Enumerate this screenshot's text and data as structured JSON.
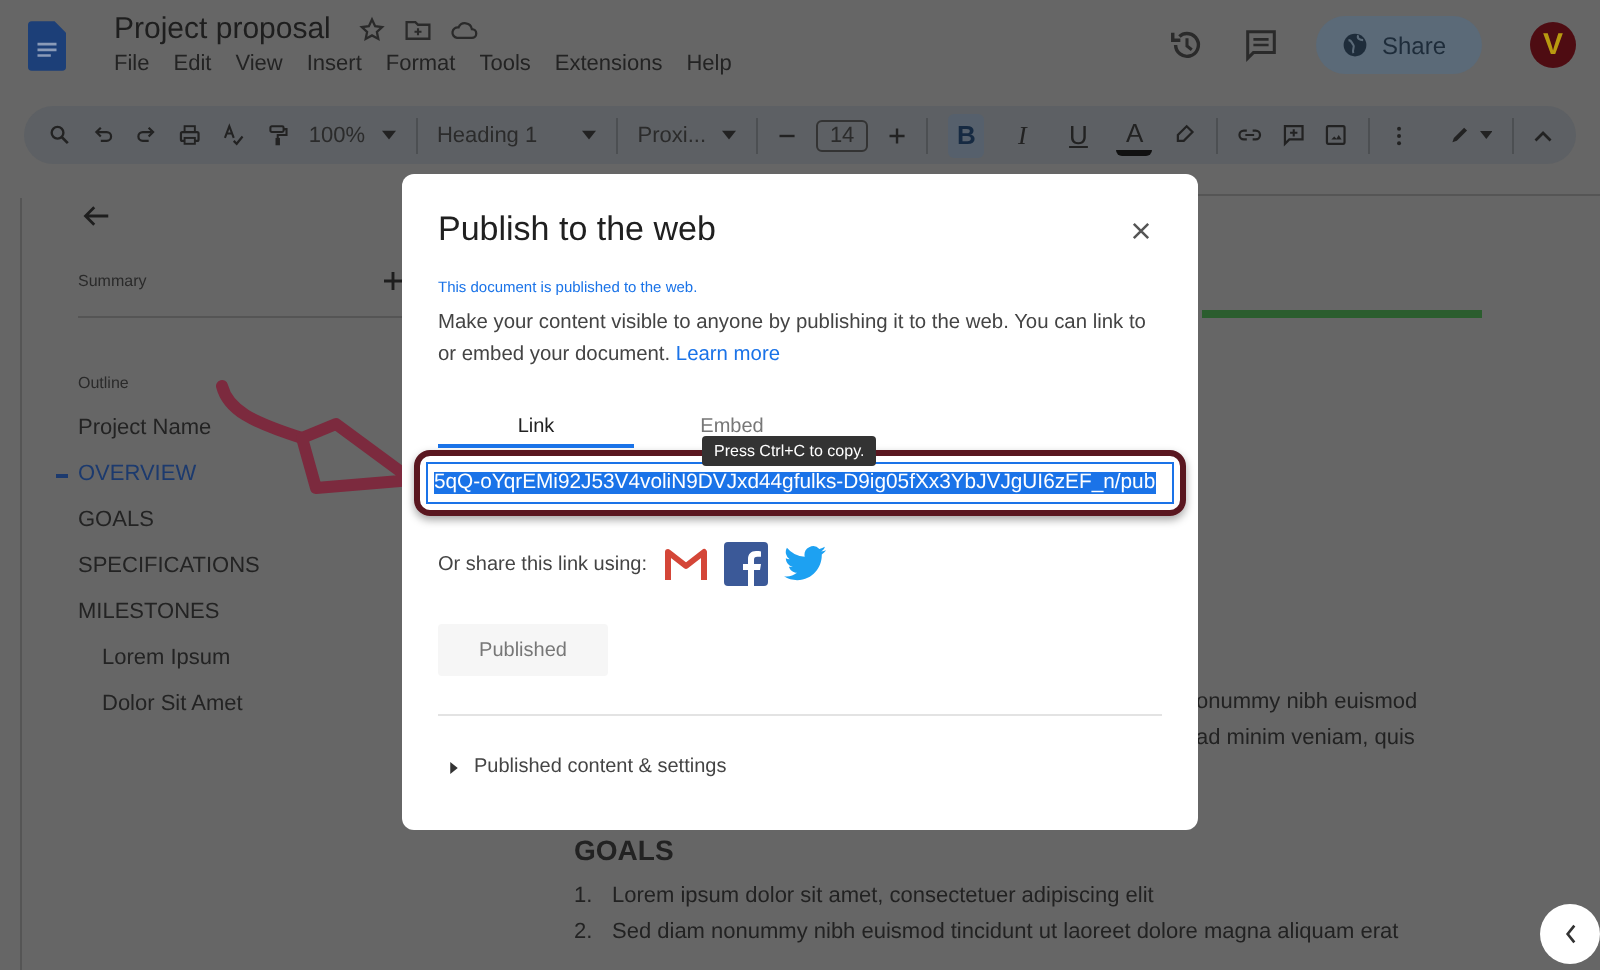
{
  "app": {
    "title": "Project proposal",
    "menu": [
      "File",
      "Edit",
      "View",
      "Insert",
      "Format",
      "Tools",
      "Extensions",
      "Help"
    ],
    "share_button": "Share",
    "avatar_letter": "V"
  },
  "toolbar": {
    "zoom": "100%",
    "style": "Heading 1",
    "font": "Proxi...",
    "font_size": "14",
    "format_buttons": [
      {
        "label": "B",
        "kind": "bold",
        "selected": true
      },
      {
        "label": "I",
        "kind": "italic",
        "selected": false
      },
      {
        "label": "U",
        "kind": "underline",
        "selected": false
      },
      {
        "label": "A",
        "kind": "color",
        "selected": false
      }
    ]
  },
  "outline": {
    "summary_label": "Summary",
    "outline_label": "Outline",
    "items": [
      {
        "label": "Project Name",
        "selected": false
      },
      {
        "label": "OVERVIEW",
        "selected": true
      },
      {
        "label": "GOALS",
        "selected": false
      },
      {
        "label": "SPECIFICATIONS",
        "selected": false
      },
      {
        "label": "MILESTONES",
        "selected": false,
        "children": [
          {
            "label": "Lorem Ipsum",
            "selected": false
          },
          {
            "label": "Dolor Sit Amet",
            "selected": false
          }
        ]
      }
    ]
  },
  "document": {
    "fragments": [
      "onummy nibh euismod",
      "ad minim veniam, quis"
    ],
    "heading": "GOALS",
    "list": [
      {
        "number": "1.",
        "text": "Lorem ipsum dolor sit amet, consectetuer adipiscing elit"
      },
      {
        "number": "2.",
        "text": "Sed diam nonummy nibh euismod tincidunt ut laoreet dolore magna aliquam erat"
      }
    ]
  },
  "dialog": {
    "title": "Publish to the web",
    "status": "This document is published to the web.",
    "description": "Make your content visible to anyone by publishing it to the web. You can link to or embed your document.",
    "learn_more": "Learn more",
    "tabs": [
      {
        "label": "Link",
        "selected": true
      },
      {
        "label": "Embed",
        "selected": false
      }
    ],
    "link": "5qQ-oYqrEMi92J53V4voliN9DVJxd44gfulks-D9ig05fXx3YbJVJgUI6zEF_n/pub",
    "tooltip": "Press Ctrl+C to copy.",
    "share_label": "Or share this link using:",
    "publish_button": "Published",
    "publish_disabled": true,
    "settings": "Published content & settings"
  }
}
